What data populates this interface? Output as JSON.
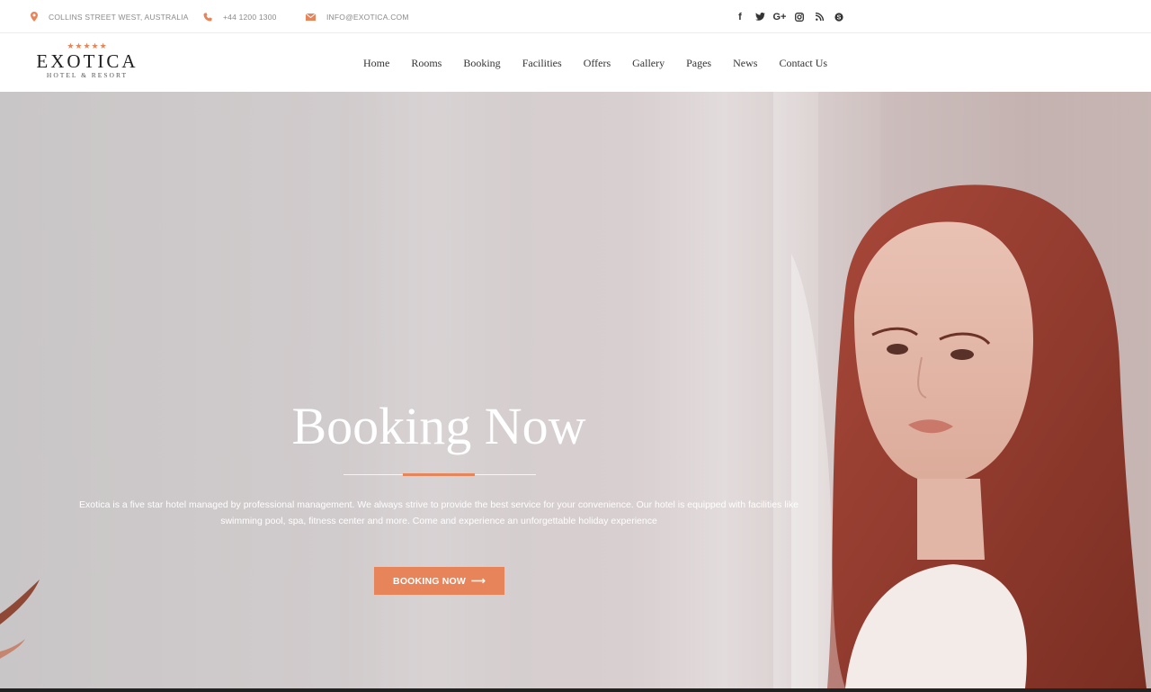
{
  "topbar": {
    "address": "COLLINS STREET WEST, AUSTRALIA",
    "phone": "+44 1200 1300",
    "email": "INFO@EXOTICA.COM",
    "social": [
      {
        "name": "facebook-icon",
        "glyph": "f"
      },
      {
        "name": "twitter-icon",
        "glyph": "t"
      },
      {
        "name": "google-plus-icon",
        "glyph": "G+"
      },
      {
        "name": "instagram-icon",
        "glyph": "◎"
      },
      {
        "name": "rss-icon",
        "glyph": "◔"
      },
      {
        "name": "skype-icon",
        "glyph": "s"
      }
    ]
  },
  "logo": {
    "stars": "★★★★★",
    "name": "EXOTICA",
    "sub": "HOTEL & RESORT"
  },
  "nav": {
    "items": [
      "Home",
      "Rooms",
      "Booking",
      "Facilities",
      "Offers",
      "Gallery",
      "Pages",
      "News",
      "Contact Us"
    ]
  },
  "hero": {
    "title": "Booking Now",
    "description": "Exotica is a five star hotel managed by professional management. We always strive to provide the best service for your convenience. Our hotel is equipped with facilities like swimming pool, spa, fitness center and more. Come and experience an unforgettable holiday experience",
    "button_label": "BOOKING NOW",
    "button_arrow": "⟶"
  },
  "colors": {
    "accent": "#e8845a",
    "text_dark": "#333333",
    "white": "#ffffff"
  }
}
